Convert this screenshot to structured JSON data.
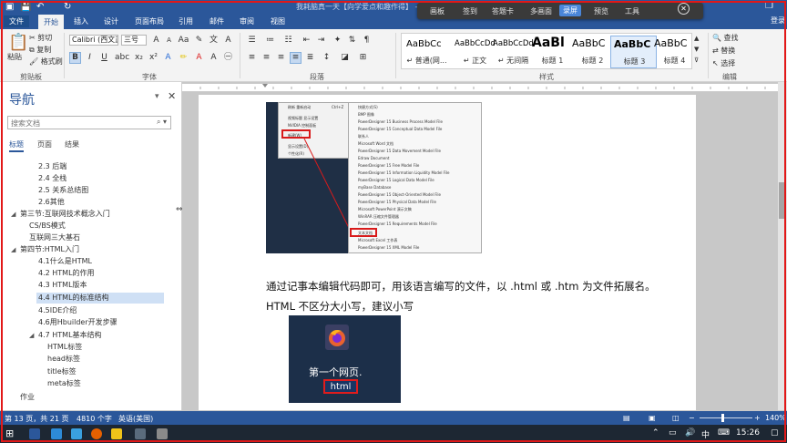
{
  "window": {
    "title": "我耗脑真一天【向学爱点和趣作得】 - Word",
    "login": "登录"
  },
  "ribbon_tabs": [
    {
      "label": "文件"
    },
    {
      "label": "开始"
    },
    {
      "label": "插入"
    },
    {
      "label": "设计"
    },
    {
      "label": "页面布局"
    },
    {
      "label": "引用"
    },
    {
      "label": "邮件"
    },
    {
      "label": "审阅"
    },
    {
      "label": "视图"
    }
  ],
  "float_bar": [
    {
      "label": "画板"
    },
    {
      "label": "签到"
    },
    {
      "label": "答题卡"
    },
    {
      "label": "多画面"
    },
    {
      "label": "录屏"
    },
    {
      "label": "预览"
    },
    {
      "label": "工具"
    }
  ],
  "clipboard": {
    "paste": "粘贴",
    "cut": "剪切",
    "copy": "复制",
    "format_painter": "格式刷",
    "label": "剪贴板"
  },
  "font": {
    "name": "Calibri (西文正文)",
    "size": "三号",
    "bold": "B",
    "italic": "I",
    "underline": "U",
    "label": "字体"
  },
  "paragraph": {
    "label": "段落"
  },
  "styles": {
    "label": "样式",
    "items": [
      {
        "preview": "AaBbCc",
        "name": "↵ 普通(网..."
      },
      {
        "preview": "AaBbCcDd",
        "name": "↵ 正文"
      },
      {
        "preview": "AaBbCcDd",
        "name": "↵ 无间隔"
      },
      {
        "preview": "AaBl",
        "name": "标题 1"
      },
      {
        "preview": "AaBbC",
        "name": "标题 2"
      },
      {
        "preview": "AaBbC",
        "name": "标题 3"
      },
      {
        "preview": "AaBbC",
        "name": "标题 4"
      }
    ]
  },
  "editing": {
    "find": "查找",
    "replace": "替换",
    "select": "选择",
    "label": "编辑"
  },
  "nav": {
    "title": "导航",
    "search_placeholder": "搜索文档",
    "tabs": [
      {
        "label": "标题"
      },
      {
        "label": "页面"
      },
      {
        "label": "结果"
      }
    ],
    "headings": [
      {
        "text": "2.3 后端"
      },
      {
        "text": "2.4 全栈"
      },
      {
        "text": "2.5 关系总结图"
      },
      {
        "text": "2.6其他"
      },
      {
        "text": "第三节:互联网技术概念入门"
      },
      {
        "text": "CS/BS模式"
      },
      {
        "text": "互联网三大基石"
      },
      {
        "text": "第四节:HTML入门"
      },
      {
        "text": "4.1什么是HTML"
      },
      {
        "text": "4.2 HTML的作用"
      },
      {
        "text": "4.3 HTML版本"
      },
      {
        "text": "4.4 HTML的标准结构"
      },
      {
        "text": "4.5IDE介绍"
      },
      {
        "text": "4.6用Hbuilder开发步骤"
      },
      {
        "text": "4.7 HTML基本结构"
      },
      {
        "text": "HTML标签"
      },
      {
        "text": "head标签"
      },
      {
        "text": "title标签"
      },
      {
        "text": "meta标签"
      },
      {
        "text": "作业"
      }
    ]
  },
  "document": {
    "context_menu_left": [
      "刷新 重新启动",
      "Ctrl+Z",
      "视频标题 显示设置",
      "NVIDIA 控制面板",
      "新建(W)",
      "显示设置(D)",
      "个性化(R)"
    ],
    "context_menu_right": [
      "快捷方式(S)",
      "BMP 图像",
      "PowerDesigner 15 Business Process Model File",
      "PowerDesigner 15 Conceptual Data Model File",
      "联系人",
      "Microsoft Word 文档",
      "PowerDesigner 15 Data Movement Model File",
      "Edraw Document",
      "PowerDesigner 15 Free Model File",
      "PowerDesigner 15 Information Liquidity Model File",
      "PowerDesigner 15 Logical Data Model File",
      "myBase Database",
      "PowerDesigner 15 Object-Oriented Model File",
      "PowerDesigner 15 Physical Data Model File",
      "Microsoft PowerPoint 演示文稿",
      "WinRAR 压缩文件管理器",
      "PowerDesigner 15 Requirements Model File",
      "文本文档",
      "Microsoft Excel 工作表",
      "PowerDesigner 15 XML Model File"
    ],
    "paragraph1": "通过记事本编辑代码即可，用该语言编写的文件，以 .html 或 .htm 为文件拓展名。",
    "paragraph2": "HTML 不区分大小写，建议小写",
    "file_icon_name": "第一个网页.",
    "file_icon_ext": "html"
  },
  "status_bar": {
    "page": "第 13 页，共 21 页",
    "words": "4810 个字",
    "language": "英语(美国)",
    "zoom": "140%"
  },
  "taskbar": {
    "time": "15:26",
    "ime": "中"
  }
}
